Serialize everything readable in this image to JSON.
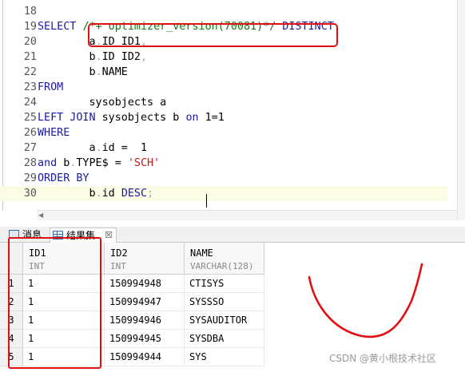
{
  "editor": {
    "lines": [
      {
        "num": "18",
        "parts": []
      },
      {
        "num": "19",
        "parts": [
          {
            "t": "SELECT ",
            "c": "kw"
          },
          {
            "t": "/*+ optimizer_version(70081)*/",
            "c": "cmt"
          },
          {
            "t": " ",
            "c": ""
          },
          {
            "t": "DISTINCT",
            "c": "kw"
          }
        ]
      },
      {
        "num": "20",
        "parts": [
          {
            "t": "        a",
            "c": ""
          },
          {
            "t": ".",
            "c": "dot"
          },
          {
            "t": "ID ID1",
            "c": ""
          },
          {
            "t": ",",
            "c": "dot"
          }
        ]
      },
      {
        "num": "21",
        "parts": [
          {
            "t": "        b",
            "c": ""
          },
          {
            "t": ".",
            "c": "dot"
          },
          {
            "t": "ID ID2",
            "c": ""
          },
          {
            "t": ",",
            "c": "dot"
          }
        ]
      },
      {
        "num": "22",
        "parts": [
          {
            "t": "        b",
            "c": ""
          },
          {
            "t": ".",
            "c": "dot"
          },
          {
            "t": "NAME",
            "c": ""
          }
        ]
      },
      {
        "num": "23",
        "parts": [
          {
            "t": "FROM",
            "c": "kw"
          }
        ]
      },
      {
        "num": "24",
        "parts": [
          {
            "t": "        sysobjects a",
            "c": ""
          }
        ]
      },
      {
        "num": "25",
        "parts": [
          {
            "t": "LEFT JOIN",
            "c": "kw"
          },
          {
            "t": " sysobjects b ",
            "c": ""
          },
          {
            "t": "on",
            "c": "kw"
          },
          {
            "t": " 1=1",
            "c": ""
          }
        ]
      },
      {
        "num": "26",
        "parts": [
          {
            "t": "WHERE",
            "c": "kw"
          }
        ]
      },
      {
        "num": "27",
        "parts": [
          {
            "t": "        a",
            "c": ""
          },
          {
            "t": ".",
            "c": "dot"
          },
          {
            "t": "id =  1",
            "c": ""
          }
        ]
      },
      {
        "num": "28",
        "parts": [
          {
            "t": "and",
            "c": "kw"
          },
          {
            "t": " b",
            "c": ""
          },
          {
            "t": ".",
            "c": "dot"
          },
          {
            "t": "TYPE$ = ",
            "c": ""
          },
          {
            "t": "'SCH'",
            "c": "str"
          }
        ]
      },
      {
        "num": "29",
        "parts": [
          {
            "t": "ORDER BY",
            "c": "kw"
          }
        ]
      },
      {
        "num": "30",
        "parts": [
          {
            "t": "        b",
            "c": ""
          },
          {
            "t": ".",
            "c": "dot"
          },
          {
            "t": "id ",
            "c": ""
          },
          {
            "t": "DESC",
            "c": "kw"
          },
          {
            "t": ";",
            "c": "dot"
          }
        ]
      }
    ]
  },
  "tabs": {
    "messages_label": "消息",
    "results_label": "结果集",
    "close_glyph": "☒"
  },
  "grid": {
    "columns": [
      {
        "name": "ID1",
        "type": "INT"
      },
      {
        "name": "ID2",
        "type": "INT"
      },
      {
        "name": "NAME",
        "type": "VARCHAR(128)"
      }
    ],
    "rows": [
      {
        "n": "1",
        "id1": "1",
        "id2": "150994948",
        "name": "CTISYS"
      },
      {
        "n": "2",
        "id1": "1",
        "id2": "150994947",
        "name": "SYSSSO"
      },
      {
        "n": "3",
        "id1": "1",
        "id2": "150994946",
        "name": "SYSAUDITOR"
      },
      {
        "n": "4",
        "id1": "1",
        "id2": "150994945",
        "name": "SYSDBA"
      },
      {
        "n": "5",
        "id1": "1",
        "id2": "150994944",
        "name": "SYS"
      }
    ]
  },
  "watermark": "CSDN @黄小根技术社区",
  "colors": {
    "keyword": "#1a1aa6",
    "string": "#c41a16",
    "comment": "#0b7a0b",
    "annotation": "#e01010"
  }
}
